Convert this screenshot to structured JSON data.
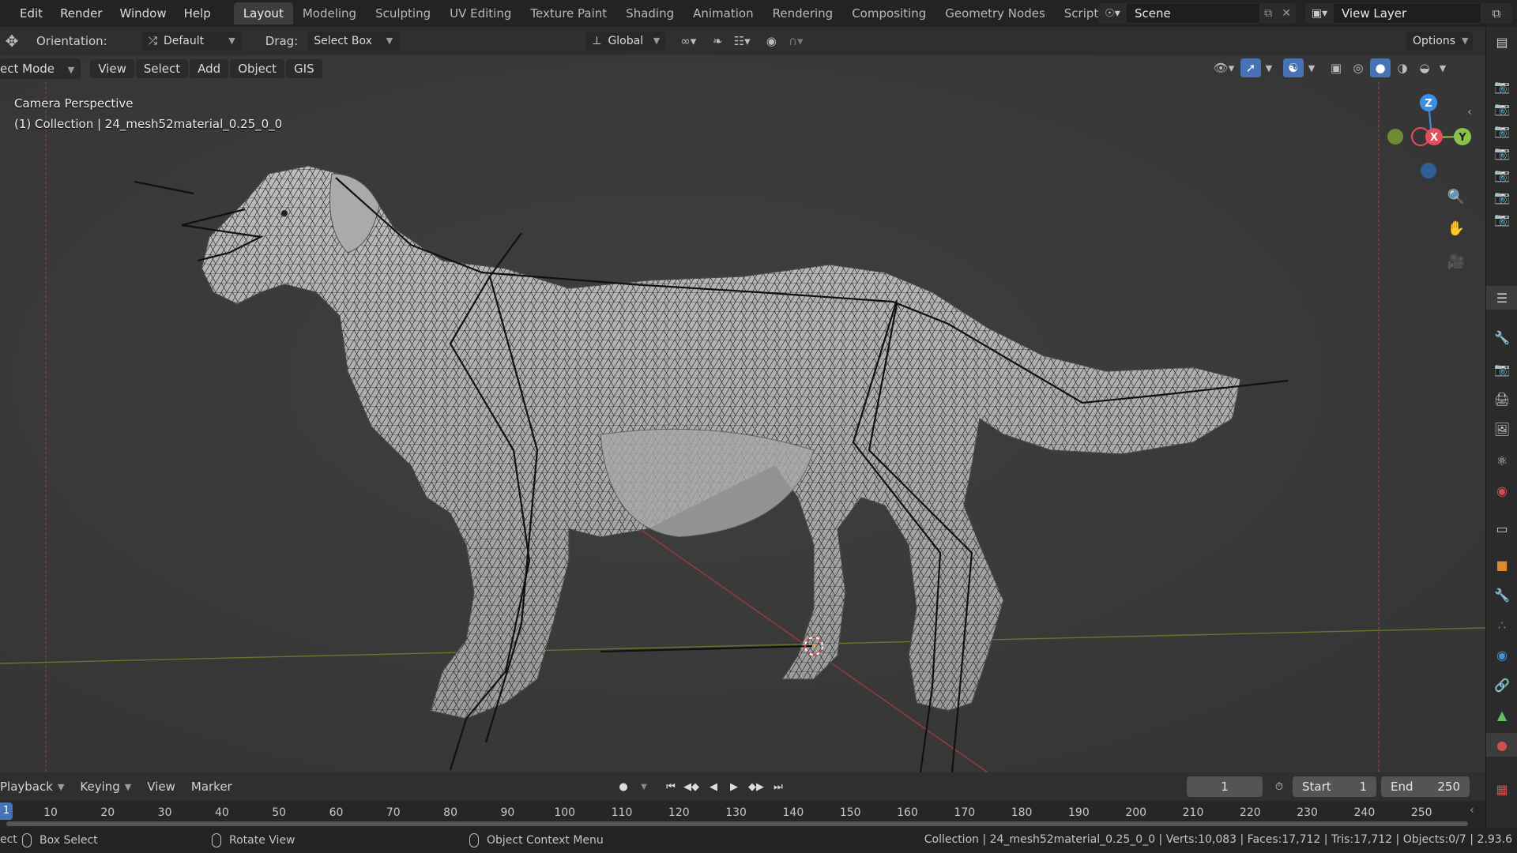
{
  "menubar": {
    "items": [
      "Edit",
      "Render",
      "Window",
      "Help"
    ],
    "workspaces": [
      "Layout",
      "Modeling",
      "Sculpting",
      "UV Editing",
      "Texture Paint",
      "Shading",
      "Animation",
      "Rendering",
      "Compositing",
      "Geometry Nodes",
      "Scripting"
    ],
    "active_workspace": "Layout",
    "add_tab": "+",
    "scene_name": "Scene",
    "view_layer_name": "View Layer"
  },
  "tool_header": {
    "orientation_label": "Orientation:",
    "orientation_value": "Default",
    "drag_label": "Drag:",
    "drag_value": "Select Box",
    "transform_orientation": "Global",
    "options_label": "Options"
  },
  "viewport_header": {
    "mode": "ect Mode",
    "menus": [
      "View",
      "Select",
      "Add",
      "Object",
      "GIS"
    ]
  },
  "viewport": {
    "perspective_label": "Camera Perspective",
    "collection_label": "(1) Collection | 24_mesh52material_0.25_0_0",
    "gizmo_axes": {
      "z": "Z",
      "x": "X",
      "y": "Y"
    }
  },
  "timeline": {
    "menus": [
      "Playback",
      "Keying",
      "View",
      "Marker"
    ],
    "current_frame": "1",
    "start_label": "Start",
    "start_value": "1",
    "end_label": "End",
    "end_value": "250",
    "ruler_start": "1",
    "ruler_ticks": [
      "10",
      "20",
      "30",
      "40",
      "50",
      "60",
      "70",
      "80",
      "90",
      "100",
      "110",
      "120",
      "130",
      "140",
      "150",
      "160",
      "170",
      "180",
      "190",
      "200",
      "210",
      "220",
      "230",
      "240",
      "250"
    ]
  },
  "statusbar": {
    "left_clip": "ect",
    "box_select": "Box Select",
    "rotate_view": "Rotate View",
    "context_menu": "Object Context Menu",
    "stats": "Collection | 24_mesh52material_0.25_0_0 | Verts:10,083 | Faces:17,712 | Tris:17,712 | Objects:0/7 | 2.93.6"
  },
  "colors": {
    "accent_blue": "#4772b3",
    "axis_x": "#e44e5d",
    "axis_y": "#8bc34a",
    "axis_z": "#3c8ee8"
  }
}
